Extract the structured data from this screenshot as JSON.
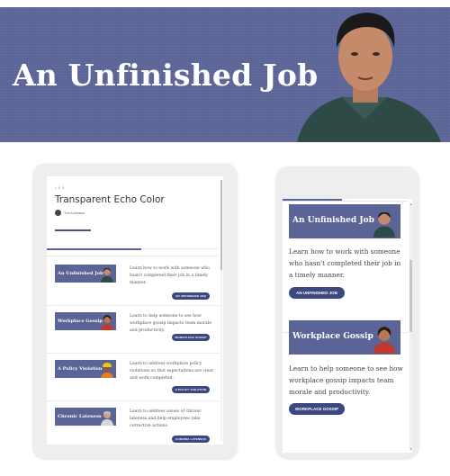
{
  "hero": {
    "title": "An Unfinished Job",
    "background_color": "#5a6496"
  },
  "tablet": {
    "course_label": "L E S",
    "title": "Transparent Echo Color",
    "author": "Tom Kuhlmann",
    "lessons": [
      {
        "thumb_label": "An Unfinished Job",
        "description": "Learn how to work with someone who hasn't completed their job in a timely manner.",
        "button": "AN UNFINISHED JOB"
      },
      {
        "thumb_label": "Workplace Gossip",
        "description": "Learn to help someone to see how workplace gossip impacts team morale and productivity.",
        "button": "WORKPLACE GOSSIP"
      },
      {
        "thumb_label": "A Policy Violation",
        "description": "Learn to address workplace policy violations so that expectations are clear and work completed.",
        "button": "A POLICY VIOLATION"
      },
      {
        "thumb_label": "Chronic Lateness",
        "description": "Learn to address issues of chronic lateness and help employees take corrective actions.",
        "button": "CHRONIC LATENESS"
      }
    ]
  },
  "phone": {
    "lessons": [
      {
        "thumb_label": "An Unfinished Job",
        "description": "Learn how to work with someone who hasn't completed their job in a timely manner.",
        "button": "AN UNFINISHED JOB"
      },
      {
        "thumb_label": "Workplace Gossip",
        "description": "Learn to help someone to see how workplace gossip impacts team morale and productivity.",
        "button": "WORKPLACE GOSSIP"
      }
    ]
  },
  "colors": {
    "accent": "#5a6496",
    "button": "#3e4880"
  }
}
